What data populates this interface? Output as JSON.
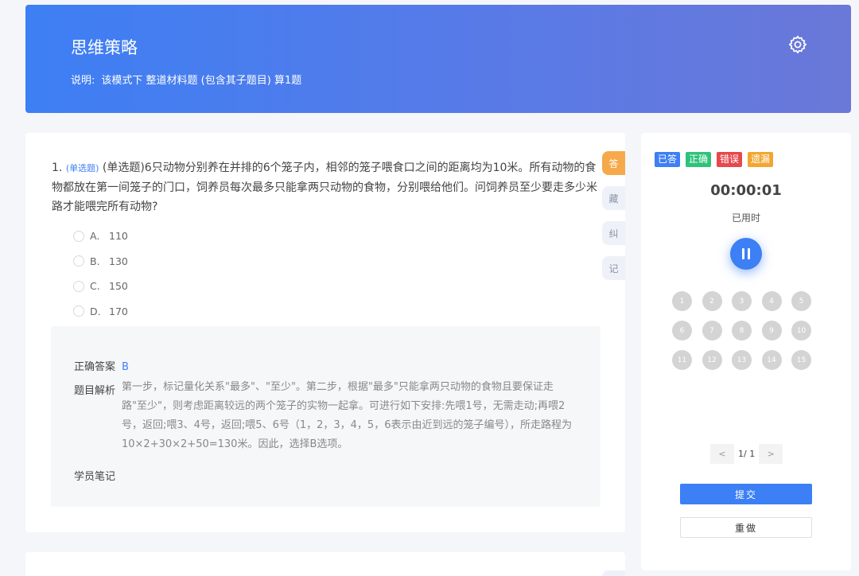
{
  "header": {
    "title": "思维策略",
    "desc_label": "说明:",
    "desc_text": "该模式下 整道材料题 (包含其子题目) 算1题"
  },
  "question": {
    "number": "1.",
    "type_tag": "(单选题)",
    "text": "(单选题)6只动物分别养在并排的6个笼子内，相邻的笼子喂食口之间的距离均为10米。所有动物的食物都放在第一间笼子的门口，饲养员每次最多只能拿两只动物的食物，分别喂给他们。问饲养员至少要走多少米路才能喂完所有动物?",
    "options": [
      {
        "letter": "A.",
        "value": "110"
      },
      {
        "letter": "B.",
        "value": "130"
      },
      {
        "letter": "C.",
        "value": "150"
      },
      {
        "letter": "D.",
        "value": "170"
      }
    ]
  },
  "answer": {
    "correct_label": "正确答案",
    "correct_value": "B",
    "analysis_label": "题目解析",
    "analysis_text": "第一步，标记量化关系\"最多\"、\"至少\"。第二步，根据\"最多\"只能拿两只动物的食物且要保证走路\"至少\"，则考虑距离较远的两个笼子的实物一起拿。可进行如下安排:先喂1号，无需走动;再喂2号，返回;喂3、4号，返回;喂5、6号（1，2，3，4，5，6表示由近到远的笼子编号），所走路程为10×2+30×2+50=130米。因此，选择B选项。",
    "notes_label": "学员笔记"
  },
  "side_tabs": [
    "答",
    "藏",
    "纠",
    "记"
  ],
  "legend": [
    {
      "label": "已答",
      "color": "#3d7ff4"
    },
    {
      "label": "正确",
      "color": "#2fc27a"
    },
    {
      "label": "错误",
      "color": "#e5484d"
    },
    {
      "label": "遗漏",
      "color": "#f2a630"
    }
  ],
  "timer": {
    "value": "00:00:01",
    "label": "已用时"
  },
  "grid": [
    "1",
    "2",
    "3",
    "4",
    "5",
    "6",
    "7",
    "8",
    "9",
    "10",
    "11",
    "12",
    "13",
    "14",
    "15"
  ],
  "pager": {
    "prev": "<",
    "info": "1/ 1",
    "next": ">"
  },
  "buttons": {
    "submit": "提交",
    "redo": "重做"
  }
}
